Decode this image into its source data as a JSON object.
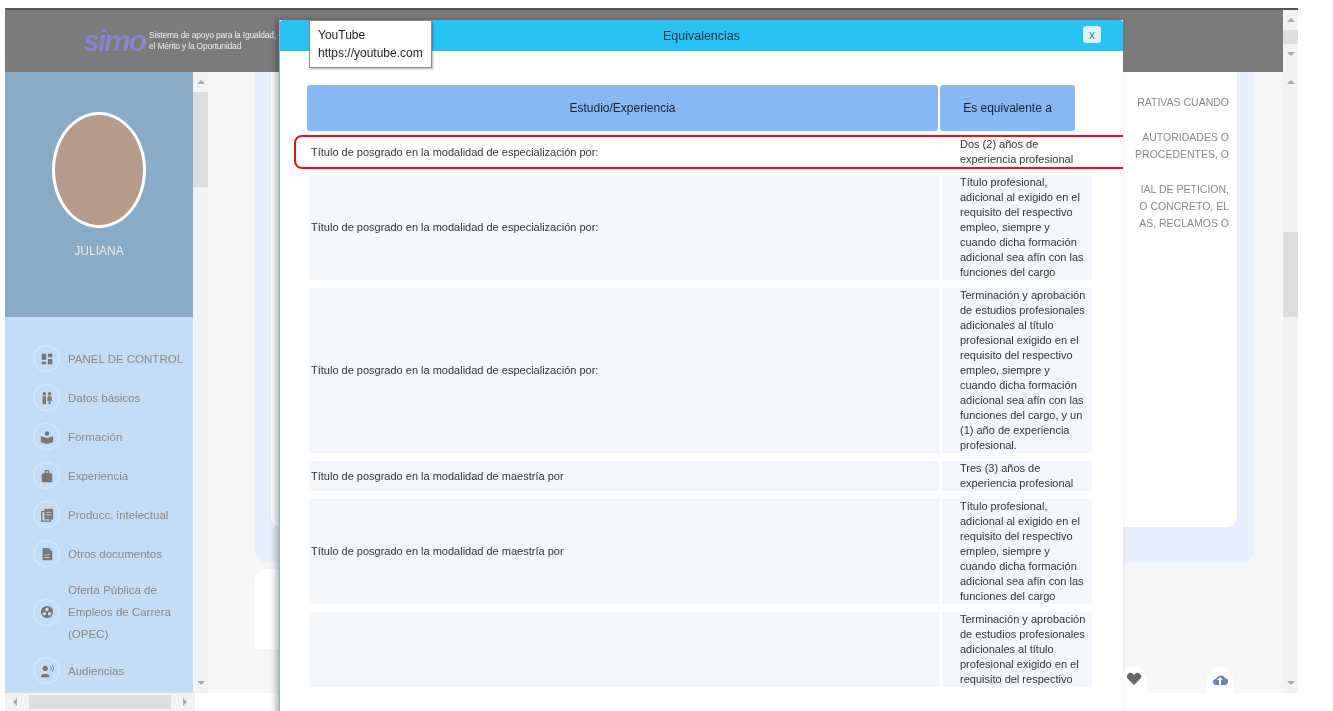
{
  "header": {
    "logo_text": "simo",
    "tagline": [
      "Sistema de apoyo para la Igualdad,",
      "el Mérito y la Oportunidad"
    ]
  },
  "profile": {
    "name": "JULIANA"
  },
  "menu": [
    {
      "label": "PANEL DE CONTROL"
    },
    {
      "label": "Datos básicos"
    },
    {
      "label": "Formación"
    },
    {
      "label": "Experiencia"
    },
    {
      "label": "Producc. intelectual"
    },
    {
      "label": "Otros documentos"
    },
    {
      "label": "Oferta Pública de Empleos de Carrera (OPEC)"
    },
    {
      "label": "Audiencias"
    }
  ],
  "background_text": [
    "RATIVAS CUANDO",
    "AUTORIDADES O",
    "PROCEDENTES, O",
    "IAL DE PETICION,",
    "O CONCRETO, EL",
    "AS, RECLAMOS O"
  ],
  "tooltip": {
    "title": "YouTube",
    "url": "https://youtube.com"
  },
  "modal": {
    "title": "Equivalencias",
    "close": "x",
    "columns": [
      "Estudio/Experiencia",
      "Es equivalente a"
    ],
    "rows": [
      {
        "study": "Título de posgrado en la modalidad de especialización por:",
        "equivalent": "Dos (2) años de experiencia profesional",
        "highlighted": true
      },
      {
        "study": "Título de posgrado en la modalidad de especialización por:",
        "equivalent": "Título profesional, adicional al exigido en el requisito del respectivo empleo, siempre y cuando dicha formación adicional sea afín con las funciones del cargo",
        "highlighted": false
      },
      {
        "study": "Título de posgrado en la modalidad de especialización por:",
        "equivalent": "Terminación y aprobación de estudios profesionales adicionales al título profesional exigido en el requisito del respectivo empleo, siempre y cuando dicha formación adicional sea afín con las funciones del cargo, y un (1) año de experiencia profesional.",
        "highlighted": false
      },
      {
        "study": "Título de posgrado en la modalidad de maestría por",
        "equivalent": "Tres (3) años de experiencia profesional",
        "highlighted": false
      },
      {
        "study": "Título de posgrado en la modalidad de maestría por",
        "equivalent": "Título profesional, adicional al exigido en el requisito del respectivo empleo, siempre y cuando dicha formación adicional sea afín con las funciones del cargo",
        "highlighted": false
      },
      {
        "study": "",
        "equivalent": "Terminación y aprobación de estudios profesionales adicionales al título profesional exigido en el requisito del respectivo",
        "highlighted": false
      }
    ]
  }
}
